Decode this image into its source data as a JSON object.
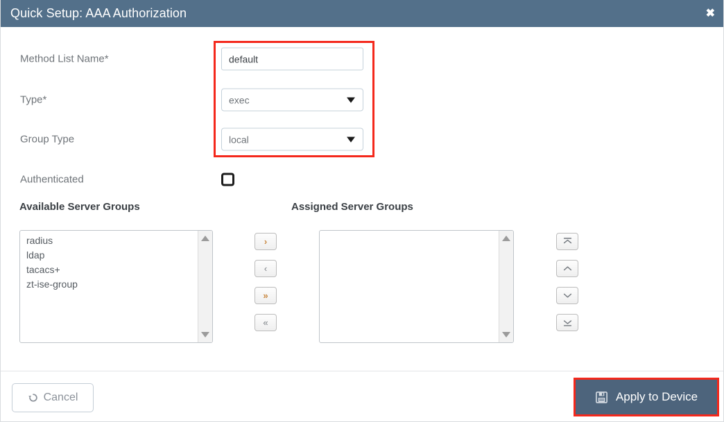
{
  "dialog": {
    "title": "Quick Setup: AAA Authorization",
    "close_icon": "close-x-icon"
  },
  "form": {
    "rows": [
      {
        "label": "Method List Name*",
        "value": "default",
        "placeholder": "",
        "type": "text"
      },
      {
        "label": "Type*",
        "value": "exec",
        "type": "select"
      },
      {
        "label": "Group Type",
        "value": "local",
        "type": "select"
      },
      {
        "label": "Authenticated",
        "value": "",
        "type": "checkbox",
        "checked": false
      }
    ]
  },
  "dual_list": {
    "available_title": "Available Server Groups",
    "assigned_title": "Assigned Server Groups",
    "available_items": [
      "radius",
      "ldap",
      "tacacs+",
      "zt-ise-group"
    ],
    "assigned_items": [],
    "transfer_buttons": [
      {
        "name": "move-right-button",
        "glyph": "›",
        "accent": true
      },
      {
        "name": "move-left-button",
        "glyph": "‹",
        "accent": false
      },
      {
        "name": "move-all-right-button",
        "glyph": "»",
        "accent": true
      },
      {
        "name": "move-all-left-button",
        "glyph": "«",
        "accent": false
      }
    ],
    "order_buttons": [
      {
        "name": "move-to-top-button",
        "icon": "bar-chevron-up-icon"
      },
      {
        "name": "move-up-button",
        "icon": "chevron-up-icon"
      },
      {
        "name": "move-down-button",
        "icon": "chevron-down-icon"
      },
      {
        "name": "move-to-bottom-button",
        "icon": "bar-chevron-down-icon"
      }
    ]
  },
  "footer": {
    "cancel_label": "Cancel",
    "cancel_icon": "undo-arrow-icon",
    "apply_label": "Apply to Device",
    "apply_icon": "floppy-save-icon"
  },
  "colors": {
    "header_bg": "#53708a",
    "apply_bg": "#4d647c",
    "highlight": "#f4281c",
    "accent_chevron": "#c8873f",
    "label_text": "#6f7479"
  }
}
